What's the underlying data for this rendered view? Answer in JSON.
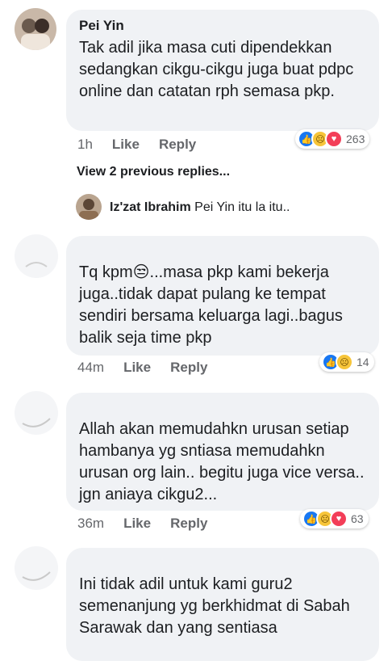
{
  "comments": [
    {
      "author": "Pei Yin",
      "text": "Tak adil jika masa cuti dipendekkan sedangkan cikgu-cikgu juga buat pdpc online dan catatan rph semasa pkp.",
      "time": "1h",
      "like": "Like",
      "reply": "Reply",
      "reaction_count": "263",
      "reactions": [
        "like-icon",
        "sad-icon",
        "love-icon"
      ]
    },
    {
      "author": "",
      "text": "Tq kpm😒...masa pkp kami bekerja juga..tidak dapat pulang ke tempat sendiri bersama keluarga lagi..bagus balik seja time pkp",
      "time": "44m",
      "like": "Like",
      "reply": "Reply",
      "reaction_count": "14",
      "reactions": [
        "like-icon",
        "sad-icon"
      ]
    },
    {
      "author": "",
      "text": "Allah akan memudahkn urusan setiap hambanya yg sntiasa memudahkn urusan org lain.. begitu juga vice versa.. jgn aniaya cikgu2...",
      "time": "36m",
      "like": "Like",
      "reply": "Reply",
      "reaction_count": "63",
      "reactions": [
        "like-icon",
        "sad-icon",
        "love-icon"
      ]
    },
    {
      "author": "",
      "text": "Ini tidak adil untuk kami guru2 semenanjung yg berkhidmat di Sabah Sarawak dan yang sentiasa"
    }
  ],
  "view_replies": "View 2 previous replies...",
  "reply_preview": {
    "author": "Iz'zat Ibrahim",
    "text": "Pei Yin itu la itu.."
  },
  "colors": {
    "bubble": "#f0f2f5",
    "like": "#1877f2",
    "love": "#f33e58",
    "sad": "#f7c53a"
  }
}
